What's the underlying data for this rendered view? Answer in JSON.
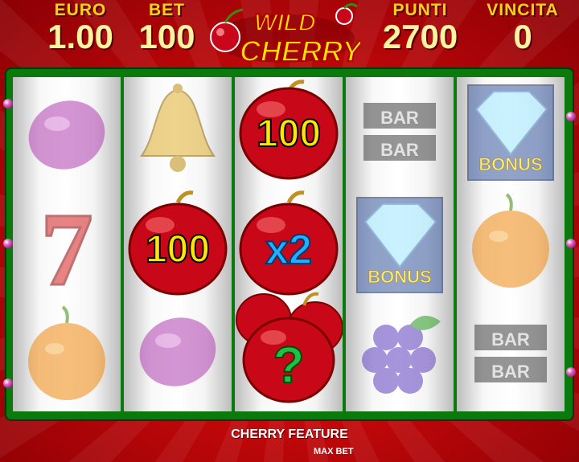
{
  "header": {
    "euro": {
      "label": "EURO",
      "value": "1.00"
    },
    "bet": {
      "label": "BET",
      "value": "100"
    },
    "punti": {
      "label": "PUNTI",
      "value": "2700"
    },
    "vincita": {
      "label": "VINCITA",
      "value": "0"
    },
    "logo": {
      "line1": "WILD",
      "line2": "CHERRY"
    }
  },
  "reels": [
    [
      "plum-icon",
      "seven-icon",
      "orange-icon"
    ],
    [
      "bell-icon",
      "cherry-100-icon",
      "plum-icon"
    ],
    [
      "cherry-100-icon",
      "cherry-x2-icon",
      "cherry-mystery-icon"
    ],
    [
      "bar-bar-icon",
      "diamond-bonus-icon",
      "grapes-icon"
    ],
    [
      "diamond-bonus-icon",
      "orange-icon",
      "bar-bar-icon"
    ]
  ],
  "symbols": {
    "cherry_100": "100",
    "cherry_x2": "x2",
    "mystery": "?",
    "bar": "BAR",
    "bonus": "BONUS",
    "seven": "7"
  },
  "footer": {
    "feature_text": "CHERRY FEATURE",
    "max_bet_label": "MAX BET"
  },
  "colors": {
    "background_red": "#c4080a",
    "frame_green": "#0a7a0c",
    "label_yellow": "#ffd21a"
  }
}
